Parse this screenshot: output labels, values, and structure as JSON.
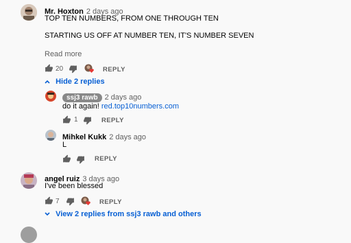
{
  "comments": [
    {
      "author": "Mr. Hoxton",
      "time": "2 days ago",
      "lines": [
        "TOP TEN NUMBERS, FROM ONE THROUGH TEN",
        "STARTING US OFF AT NUMBER TEN, IT'S NUMBER SEVEN"
      ],
      "read_more": "Read more",
      "likes": "20",
      "reply_label": "REPLY",
      "toggle_label": "Hide 2 replies",
      "replies": [
        {
          "author": "ssj3 rawb",
          "time": "2 days ago",
          "text_prefix": "do it again! ",
          "link": "red.top10numbers.com",
          "likes": "1",
          "reply_label": "REPLY"
        },
        {
          "author": "Mihkel Kukk",
          "time": "2 days ago",
          "text": "L",
          "reply_label": "REPLY"
        }
      ]
    },
    {
      "author": "angel ruiz",
      "time": "3 days ago",
      "text": "I've been blessed",
      "likes": "7",
      "reply_label": "REPLY",
      "toggle_label": "View 2 replies from ssj3 rawb and others"
    }
  ],
  "colors": {
    "link": "#065fd4",
    "muted": "#606060",
    "heart": "#e53935",
    "background": "#f9f9f9"
  }
}
